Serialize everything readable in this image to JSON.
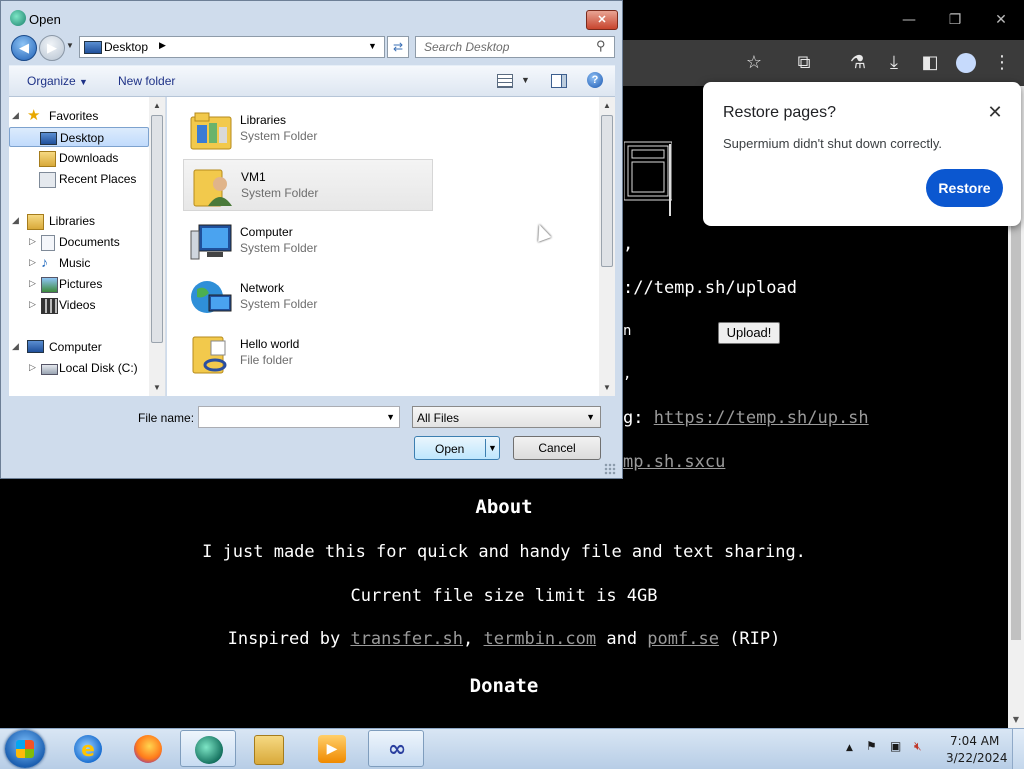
{
  "dialog": {
    "title": "Open",
    "address": "Desktop",
    "search_placeholder": "Search Desktop",
    "organize_label": "Organize",
    "new_folder_label": "New folder",
    "nav_pane": [
      {
        "label": "Favorites",
        "type": "group"
      },
      {
        "label": "Desktop",
        "selected": true
      },
      {
        "label": "Downloads"
      },
      {
        "label": "Recent Places"
      },
      {
        "label": "Libraries",
        "type": "group"
      },
      {
        "label": "Documents"
      },
      {
        "label": "Music"
      },
      {
        "label": "Pictures"
      },
      {
        "label": "Videos"
      },
      {
        "label": "Computer",
        "type": "group"
      },
      {
        "label": "Local Disk (C:)"
      }
    ],
    "files": [
      {
        "name": "Libraries",
        "type": "System Folder",
        "icon": "libraries-icon"
      },
      {
        "name": "VM1",
        "type": "System Folder",
        "icon": "user-folder-icon",
        "selected": true
      },
      {
        "name": "Computer",
        "type": "System Folder",
        "icon": "computer-icon"
      },
      {
        "name": "Network",
        "type": "System Folder",
        "icon": "network-icon"
      },
      {
        "name": "Hello world",
        "type": "File folder",
        "icon": "folder-icon"
      }
    ],
    "file_name_label": "File name:",
    "file_name_value": "",
    "filter_value": "All Files",
    "open_label": "Open",
    "cancel_label": "Cancel"
  },
  "browser": {
    "page": {
      "url_text": "://temp.sh/upload",
      "upload_button": "Upload!",
      "link_up_sh_prefix": "g: ",
      "link_up_sh": "https://temp.sh/up.sh",
      "link_sxcu": "mp.sh.sxcu",
      "about_heading": "About",
      "about_text": "I just made this for quick and handy file and text sharing.",
      "limit_text": "Current file size limit is 4GB",
      "inspired_prefix": "Inspired by ",
      "inspired_link1": "transfer.sh",
      "inspired_sep1": ", ",
      "inspired_link2": "termbin.com",
      "inspired_sep2": " and ",
      "inspired_link3": "pomf.se",
      "inspired_suffix": " (RIP)",
      "donate_heading": "Donate",
      "fragment_n": "n",
      "fragment_comma": ","
    },
    "restore_popup": {
      "title": "Restore pages?",
      "message": "Supermium didn't shut down correctly.",
      "button": "Restore"
    }
  },
  "taskbar": {
    "apps": [
      "internet-explorer-icon",
      "firefox-icon",
      "supermium-icon",
      "explorer-icon",
      "media-player-icon",
      "vm-icon"
    ],
    "time": "7:04 AM",
    "date": "3/22/2024"
  }
}
